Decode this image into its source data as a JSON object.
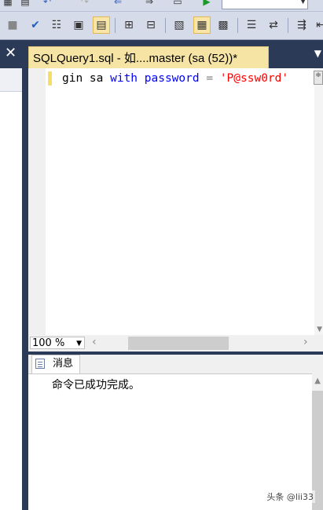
{
  "tab": {
    "title": "SQLQuery1.sql - 如....master (sa (52))*"
  },
  "editor": {
    "code_prefix": "gin sa ",
    "kw_with": "with",
    "kw_password": "password",
    "op_eq": "=",
    "string_literal": "'P@ssw0rd'"
  },
  "zoom": {
    "value": "100 %"
  },
  "results": {
    "tab_label": "消息",
    "message": "命令已成功完成。"
  },
  "watermark": "头条 @lii33",
  "icons": [
    "stop-icon",
    "check-icon",
    "parse-icon",
    "display-plan-icon",
    "results-to-icon",
    "include-plan-icon",
    "client-stats-icon",
    "comment-icon",
    "uncomment-icon",
    "indent-icon",
    "outdent-icon",
    "specify-values-icon",
    "execute-icon"
  ]
}
